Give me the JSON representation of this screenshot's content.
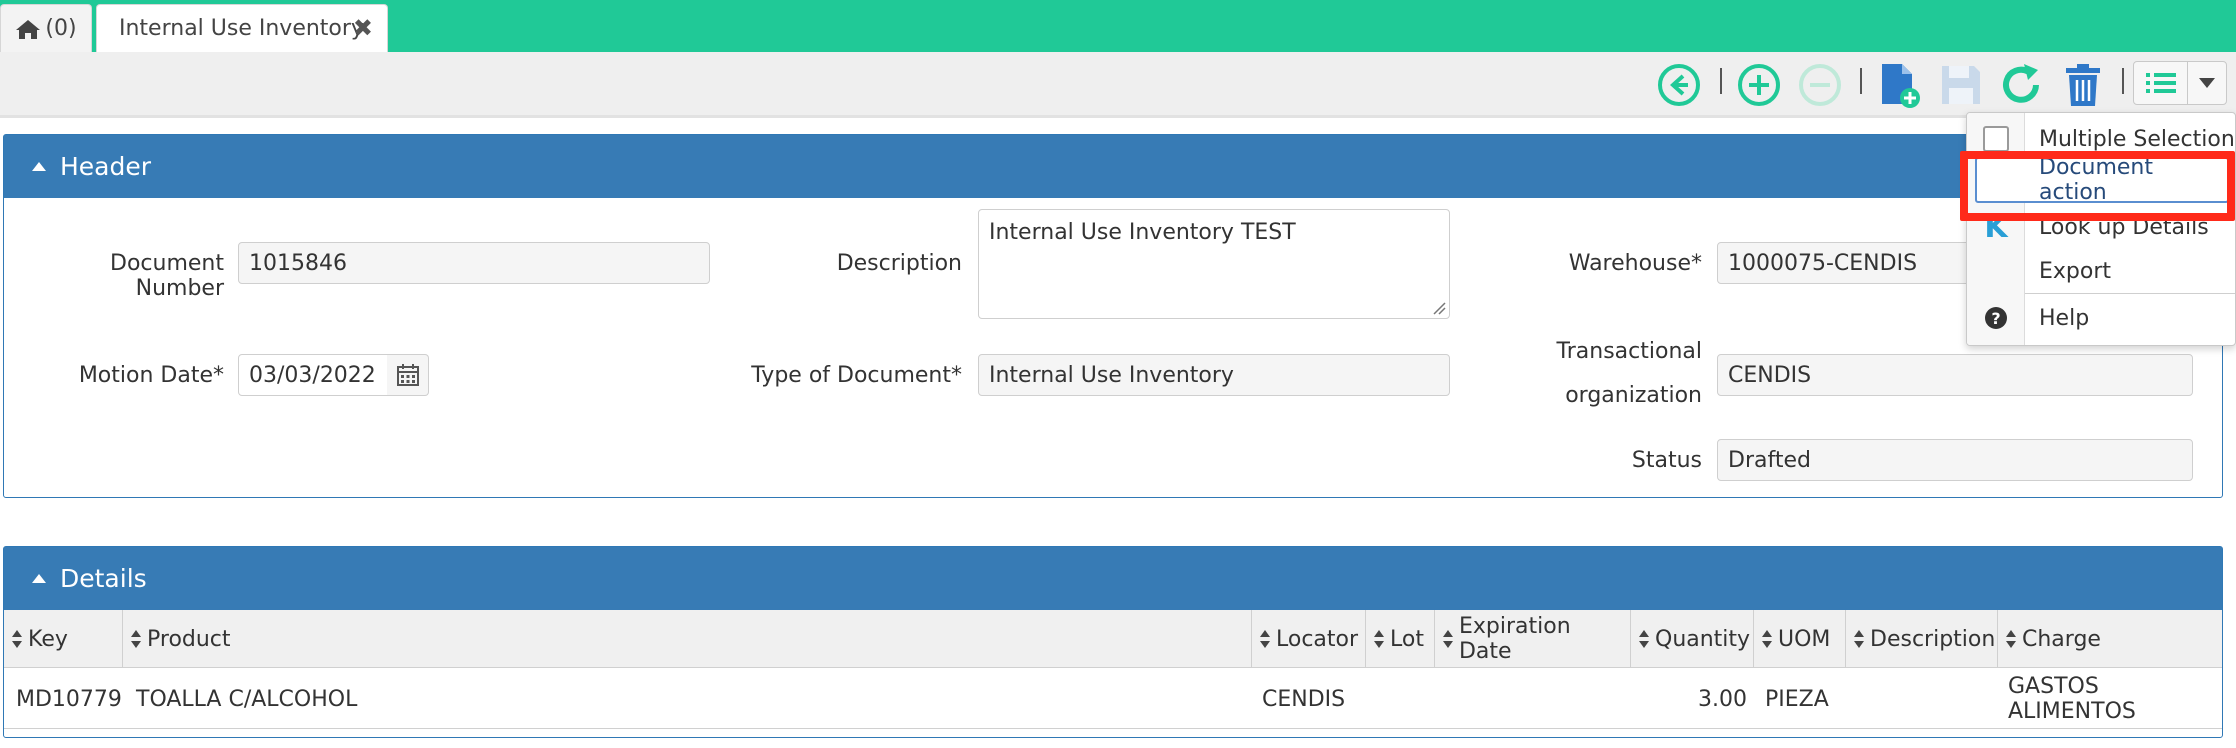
{
  "tabs": {
    "home_count": "(0)",
    "active_title": "Internal Use Inventory",
    "close_glyph": "✖"
  },
  "toolbar": {
    "icons": [
      "back-icon",
      "add-icon",
      "remove-icon",
      "new-document-icon",
      "save-icon",
      "refresh-icon",
      "delete-icon",
      "list-icon",
      "caret-down-icon"
    ],
    "accent_green": "#20c997",
    "accent_blue": "#2f78c8"
  },
  "header_panel": {
    "title": "Header",
    "document_number": {
      "label": "Document Number",
      "value": "1015846"
    },
    "description": {
      "label": "Description",
      "value": "Internal Use Inventory TEST"
    },
    "warehouse": {
      "label": "Warehouse*",
      "value": "1000075-CENDIS"
    },
    "motion_date": {
      "label": "Motion Date*",
      "value": "03/03/2022"
    },
    "type_of_document": {
      "label": "Type of Document*",
      "value": "Internal Use Inventory"
    },
    "transactional_org": {
      "label_line1": "Transactional",
      "label_line2": "organization",
      "value": "CENDIS"
    },
    "status": {
      "label": "Status",
      "value": "Drafted"
    }
  },
  "details_panel": {
    "title": "Details",
    "columns": [
      "Key",
      "Product",
      "Locator",
      "Lot",
      "Expiration Date",
      "Quantity",
      "UOM",
      "Description",
      "Charge"
    ],
    "rows": [
      {
        "key": "MD10779",
        "product": "TOALLA C/ALCOHOL",
        "locator": "CENDIS",
        "lot": "",
        "expiration_date": "",
        "quantity": "3.00",
        "uom": "PIEZA",
        "description": "",
        "charge": "GASTOS ALIMENTOS"
      }
    ]
  },
  "dropdown_menu": {
    "items": [
      {
        "label": "Multiple Selection",
        "icon": "checkbox-icon"
      },
      {
        "label": "Document action",
        "icon": "",
        "selected": true
      },
      {
        "label": "Look up Details",
        "icon": "k-letter-icon"
      },
      {
        "label": "Export",
        "icon": ""
      },
      {
        "label": "Help",
        "icon": "question-circle-icon"
      }
    ],
    "k_glyph": "K",
    "help_glyph": "?",
    "highlight_color": "#ff2a1a"
  }
}
